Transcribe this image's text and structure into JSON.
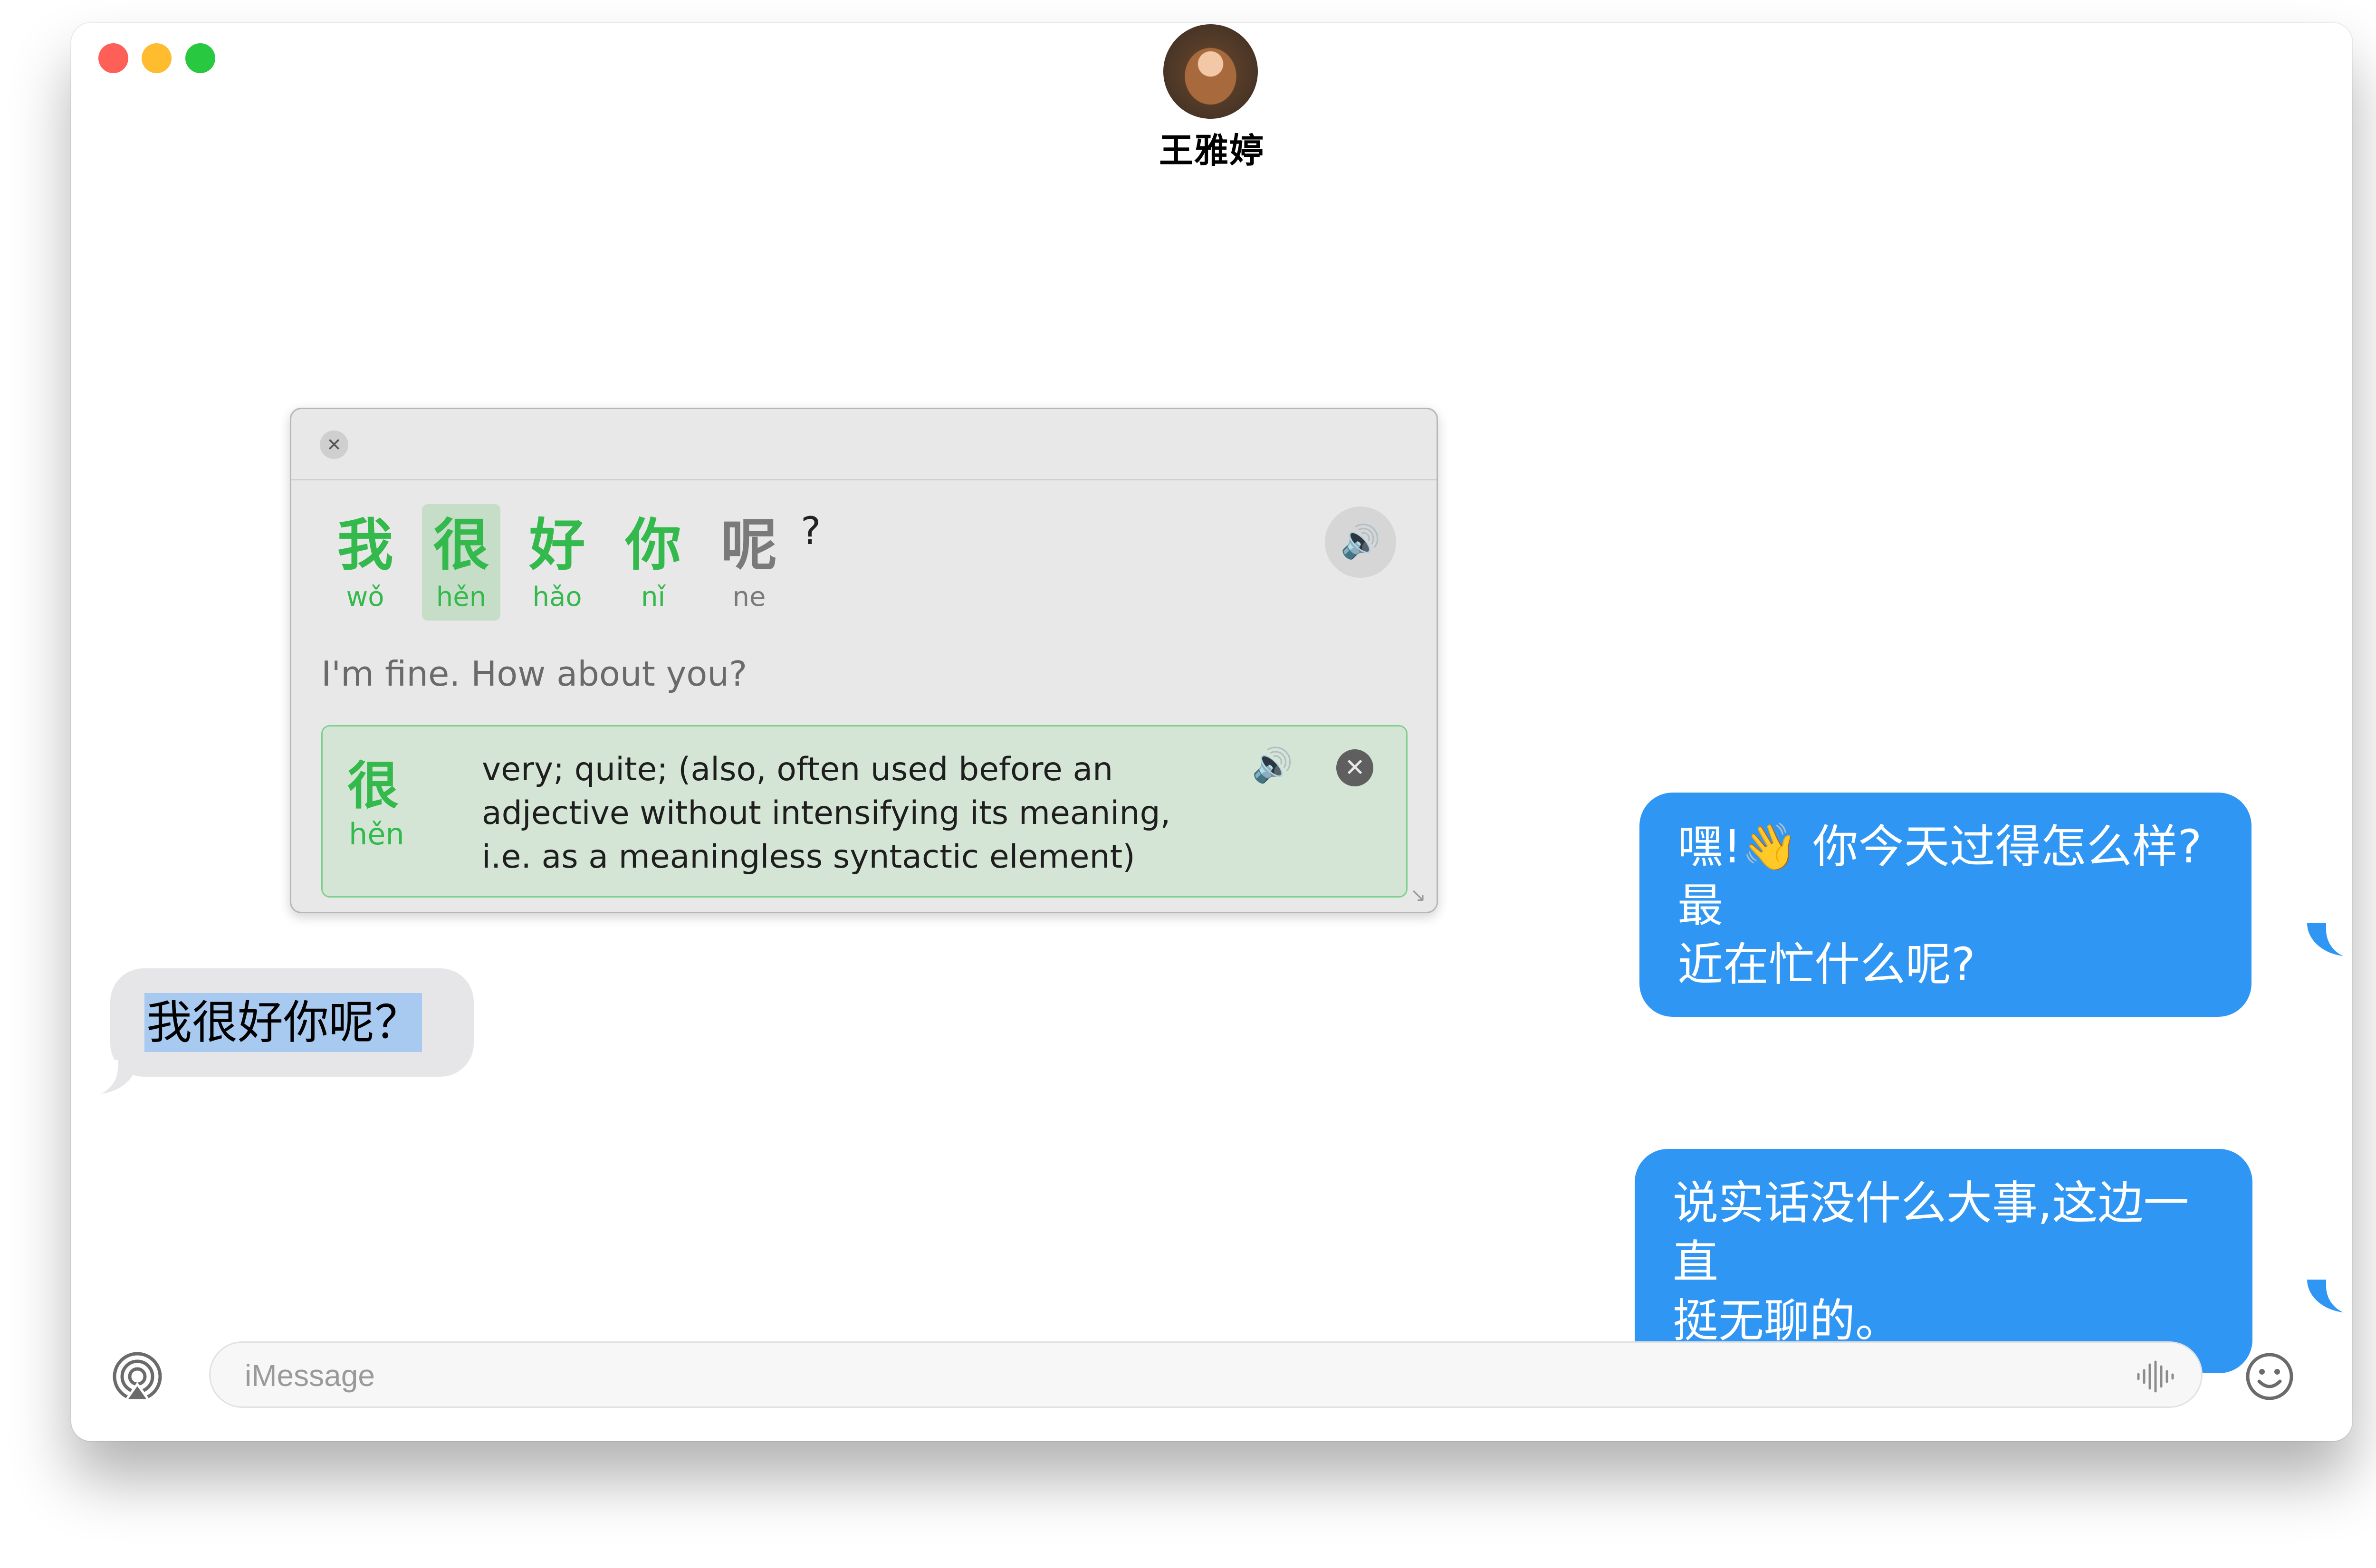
{
  "window": {
    "traffic_lights": {
      "close": "#fe5f57",
      "minimize": "#febc2e",
      "zoom": "#28c840"
    }
  },
  "header": {
    "contact_name": "王雅婷",
    "avatar": "contact-avatar"
  },
  "translation_popover": {
    "close_icon": "close-icon",
    "characters": [
      {
        "hanzi": "我",
        "pinyin": "wǒ",
        "selected": false,
        "color": "#33b94c"
      },
      {
        "hanzi": "很",
        "pinyin": "hěn",
        "selected": true,
        "color": "#33b94c"
      },
      {
        "hanzi": "好",
        "pinyin": "hǎo",
        "selected": false,
        "color": "#33b94c"
      },
      {
        "hanzi": "你",
        "pinyin": "nǐ",
        "selected": false,
        "color": "#33b94c"
      },
      {
        "hanzi": "呢",
        "pinyin": "ne",
        "selected": false,
        "color": "#7a7a7a"
      }
    ],
    "punctuation": "?",
    "speak_icon": "speaker-icon",
    "translation": "I'm fine. How about you?",
    "definition": {
      "hanzi": "很",
      "pinyin": "hěn",
      "text_lines": [
        "very; quite; (also, often used before an",
        "adjective without intensifying its meaning,",
        "i.e. as a meaningless syntactic element)"
      ],
      "speak_icon": "speaker-icon",
      "close_icon": "close-circle-icon"
    }
  },
  "messages": [
    {
      "direction": "outgoing",
      "lines": [
        "嘿!👋 你今天过得怎么样?最",
        "近在忙什么呢?"
      ],
      "color": "#2f96f4"
    },
    {
      "direction": "incoming",
      "text": "我很好你呢？",
      "highlighted": true,
      "color": "#e6e6e9"
    },
    {
      "direction": "outgoing",
      "lines": [
        "说实话没什么大事,这边一直",
        "挺无聊的。"
      ],
      "color": "#2f96f4"
    }
  ],
  "compose": {
    "placeholder": "iMessage",
    "value": "",
    "apps_icon": "app-store-icon",
    "audio_icon": "waveform-icon",
    "emoji_icon": "emoji-icon"
  }
}
